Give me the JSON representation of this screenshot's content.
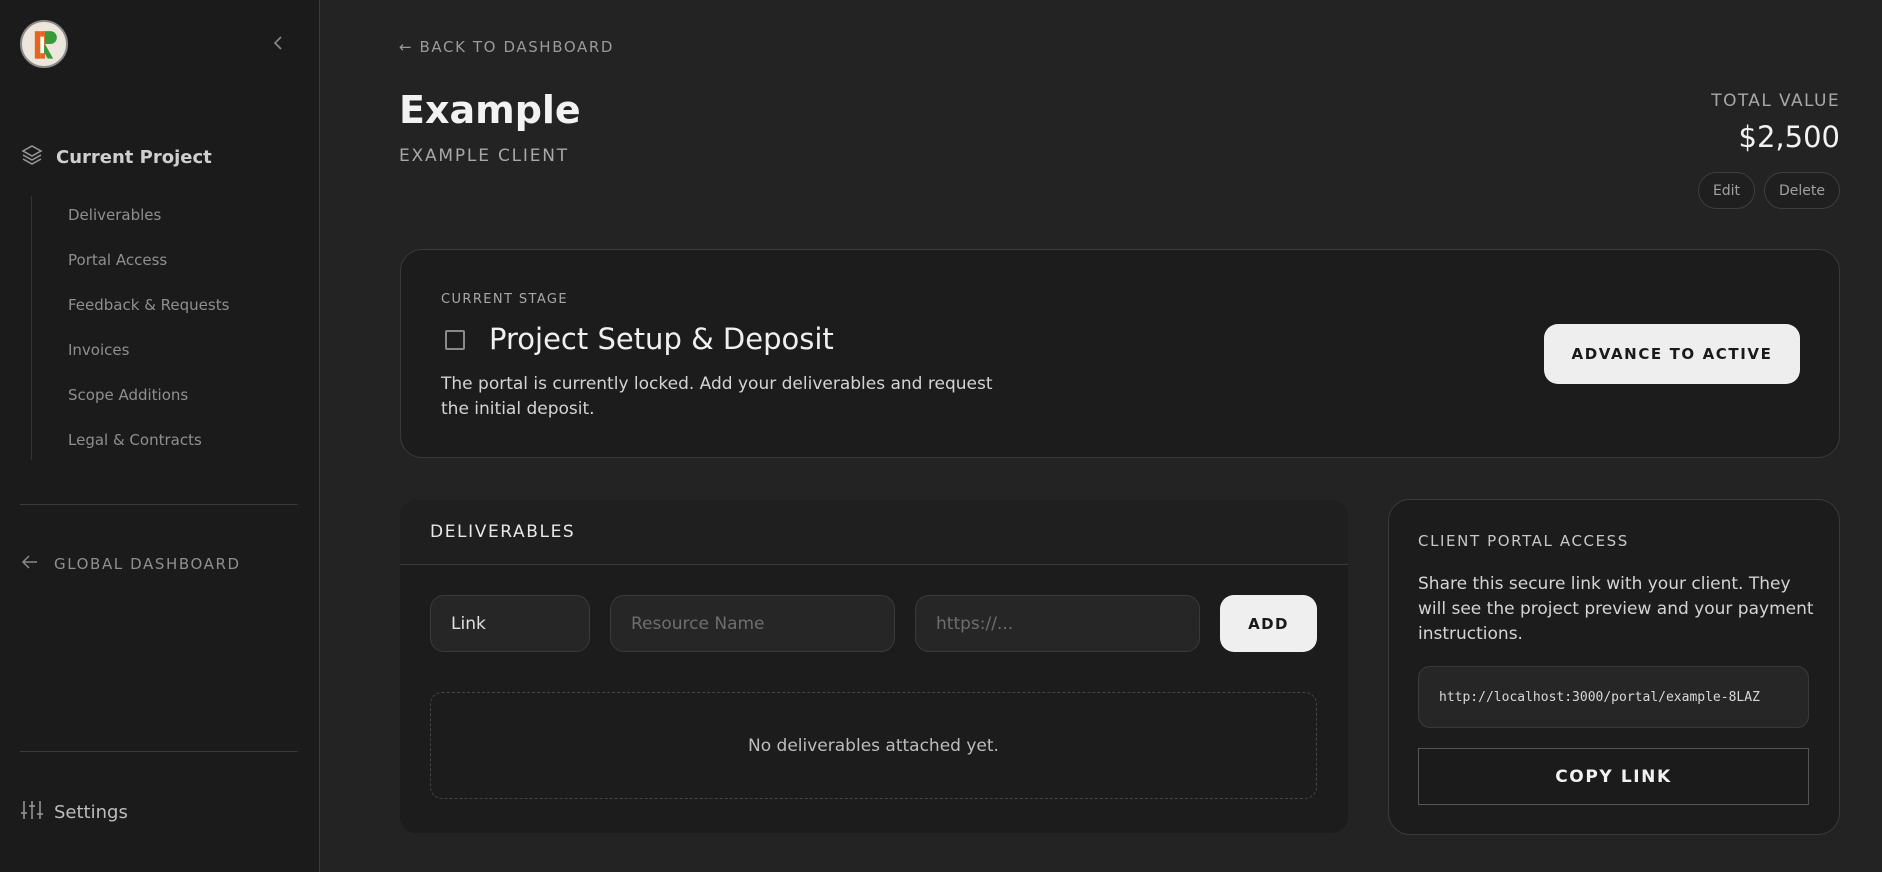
{
  "sidebar": {
    "logo_icon": "brand-logo-icon",
    "collapse_icon": "chevron-left-icon",
    "section": {
      "icon": "layers-icon",
      "label": "Current Project"
    },
    "items": [
      {
        "label": "Deliverables"
      },
      {
        "label": "Portal Access"
      },
      {
        "label": "Feedback & Requests"
      },
      {
        "label": "Invoices"
      },
      {
        "label": "Scope Additions"
      },
      {
        "label": "Legal & Contracts"
      }
    ],
    "global_dashboard": {
      "icon": "arrow-left-icon",
      "label": "GLOBAL DASHBOARD"
    },
    "settings": {
      "icon": "sliders-icon",
      "label": "Settings"
    }
  },
  "header": {
    "back_link": "← BACK TO DASHBOARD",
    "title": "Example",
    "client": "EXAMPLE CLIENT",
    "total_label": "TOTAL VALUE",
    "total_value": "$2,500",
    "edit_label": "Edit",
    "delete_label": "Delete"
  },
  "stage": {
    "label": "CURRENT STAGE",
    "title": "Project Setup & Deposit",
    "checked": false,
    "description": "The portal is currently locked. Add your deliverables and request the initial deposit.",
    "advance_label": "ADVANCE TO ACTIVE"
  },
  "deliverables": {
    "title": "DELIVERABLES",
    "type_value": "Link",
    "name_placeholder": "Resource Name",
    "url_placeholder": "https://...",
    "add_label": "ADD",
    "empty_text": "No deliverables attached yet."
  },
  "portal": {
    "title": "CLIENT PORTAL ACCESS",
    "description": "Share this secure link with your client. They will see the project preview and your payment instructions.",
    "link": "http://localhost:3000/portal/example-8LAZ",
    "copy_label": "COPY LINK"
  },
  "colors": {
    "background": "#232323",
    "sidebar": "#1b1b1b",
    "card": "#1c1c1c",
    "primary_button": "#eeeeee"
  }
}
